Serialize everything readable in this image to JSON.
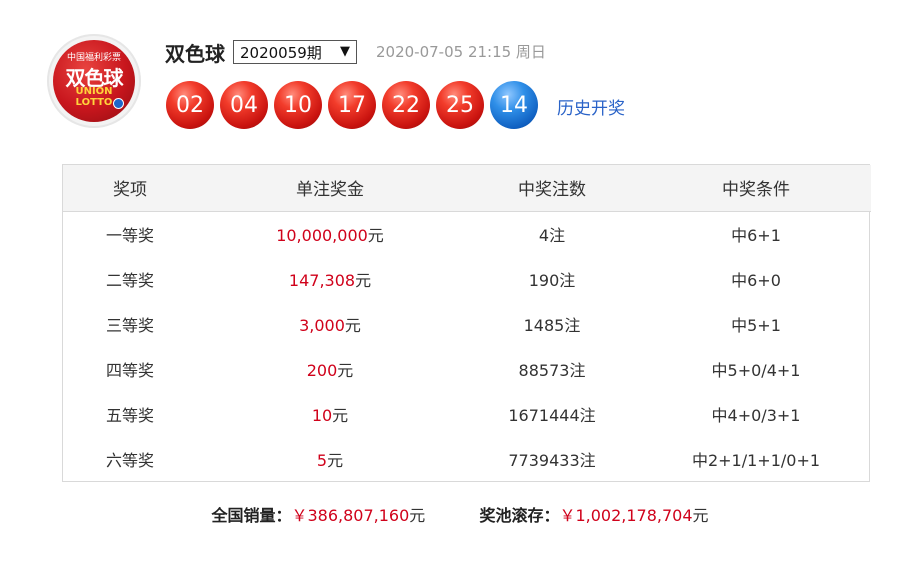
{
  "logo": {
    "top_text": "中国福利彩票",
    "cn_text": "双色球",
    "en_text": "UNION LOTTO"
  },
  "header": {
    "title": "双色球",
    "issue": "2020059期",
    "issue_caret": "▼",
    "datetime": "2020-07-05 21:15 周日",
    "history_link": "历史开奖"
  },
  "balls": {
    "red": [
      "02",
      "04",
      "10",
      "17",
      "22",
      "25"
    ],
    "blue": "14"
  },
  "table": {
    "headers": [
      "奖项",
      "单注奖金",
      "中奖注数",
      "中奖条件"
    ],
    "rows": [
      [
        "一等奖",
        "10,000,000",
        "元",
        "4注",
        "中6+1"
      ],
      [
        "二等奖",
        "147,308",
        "元",
        "190注",
        "中6+0"
      ],
      [
        "三等奖",
        "3,000",
        "元",
        "1485注",
        "中5+1"
      ],
      [
        "四等奖",
        "200",
        "元",
        "88573注",
        "中5+0/4+1"
      ],
      [
        "五等奖",
        "10",
        "元",
        "1671444注",
        "中4+0/3+1"
      ],
      [
        "六等奖",
        "5",
        "元",
        "7739433注",
        "中2+1/1+1/0+1"
      ]
    ]
  },
  "summary": {
    "sales_label": "全国销量：",
    "sales_value": "￥386,807,160",
    "sales_unit": "元",
    "pool_label": "奖池滚存：",
    "pool_value": "￥1,002,178,704",
    "pool_unit": "元"
  },
  "colors": {
    "red_ball": "#d9251d",
    "blue_ball": "#1570d1",
    "money": "#d0021b",
    "link": "#2a63c8"
  }
}
